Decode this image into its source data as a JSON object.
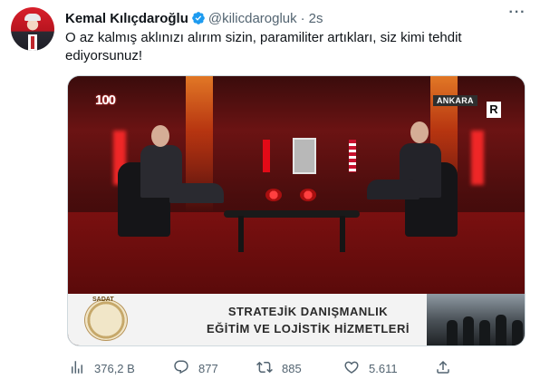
{
  "tweet": {
    "author": {
      "name": "Kemal Kılıçdaroğlu",
      "handle": "@kilicdarogluk",
      "separator": "·",
      "time": "2s",
      "verified_icon": "verified-badge-icon",
      "verified_color": "#1d9bf0"
    },
    "more_label": "···",
    "text": "O az kalmış aklınızı alırım sizin, paramiliter artıkları, siz kimi tehdit ediyorsunuz!",
    "media": {
      "logo_100": "100",
      "location_tag": "ANKARA",
      "channel_logo": "R",
      "banner": {
        "seal_text": "SADAT",
        "line1": "STRATEJİK DANIŞMANLIK",
        "line2": "EĞİTİM VE LOJİSTİK HİZMETLERİ"
      }
    },
    "actions": {
      "views": {
        "icon": "analytics-icon",
        "value": "376,2 B"
      },
      "replies": {
        "icon": "reply-icon",
        "value": "877"
      },
      "retweets": {
        "icon": "retweet-icon",
        "value": "885"
      },
      "likes": {
        "icon": "like-icon",
        "value": "5.611"
      },
      "share": {
        "icon": "share-icon"
      }
    },
    "colors": {
      "text": "#0f1419",
      "secondary": "#536471",
      "border": "#cfd9de"
    }
  }
}
